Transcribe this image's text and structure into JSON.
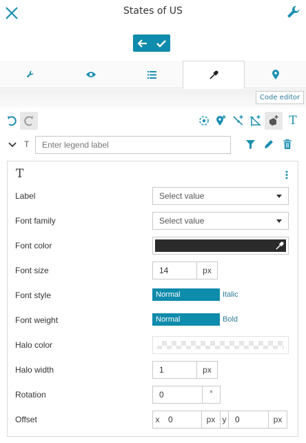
{
  "header": {
    "title": "States of US"
  },
  "toolbar_panel": {
    "code_editor_label": "Code editor"
  },
  "legend": {
    "placeholder": "Enter legend label",
    "type_glyph": "T"
  },
  "panel": {
    "type_glyph": "T",
    "rows": {
      "label": {
        "label": "Label",
        "value": "Select value"
      },
      "font_family": {
        "label": "Font family",
        "value": "Select value"
      },
      "font_color": {
        "label": "Font color",
        "value": "#2b2b2b"
      },
      "font_size": {
        "label": "Font size",
        "value": "14",
        "unit": "px"
      },
      "font_style": {
        "label": "Font style",
        "selected": "Normal",
        "other": "Italic"
      },
      "font_weight": {
        "label": "Font weight",
        "selected": "Normal",
        "other": "Bold"
      },
      "halo_color": {
        "label": "Halo color"
      },
      "halo_width": {
        "label": "Halo width",
        "value": "1",
        "unit": "px"
      },
      "rotation": {
        "label": "Rotation",
        "value": "0",
        "unit": "°"
      },
      "offset": {
        "label": "Offset",
        "x_label": "x",
        "x_value": "0",
        "x_unit": "px",
        "y_label": "y",
        "y_value": "0",
        "y_unit": "px"
      }
    }
  },
  "colors": {
    "accent": "#0f8bab",
    "link": "#2c7c9a"
  }
}
